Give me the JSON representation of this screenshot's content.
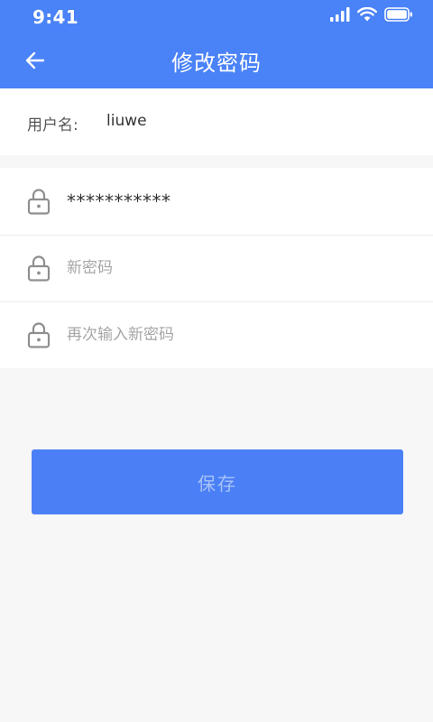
{
  "status_bar": {
    "time": "9:41",
    "icons": [
      "cellular-signal-icon",
      "wifi-icon",
      "battery-icon"
    ]
  },
  "header": {
    "title": "修改密码",
    "back_icon": "arrow-left-icon"
  },
  "user": {
    "label": "用户名:",
    "value": "liuwe"
  },
  "password_fields": {
    "old_password": {
      "value": "***********",
      "icon": "lock-icon"
    },
    "new_password": {
      "placeholder": "新密码",
      "icon": "lock-icon"
    },
    "confirm_password": {
      "placeholder": "再次输入新密码",
      "icon": "lock-icon"
    }
  },
  "actions": {
    "save_label": "保存"
  },
  "colors": {
    "primary": "#4a82f7",
    "button": "#4a7ff6",
    "button_text": "#a8c3f7",
    "background": "#f7f7f7"
  }
}
